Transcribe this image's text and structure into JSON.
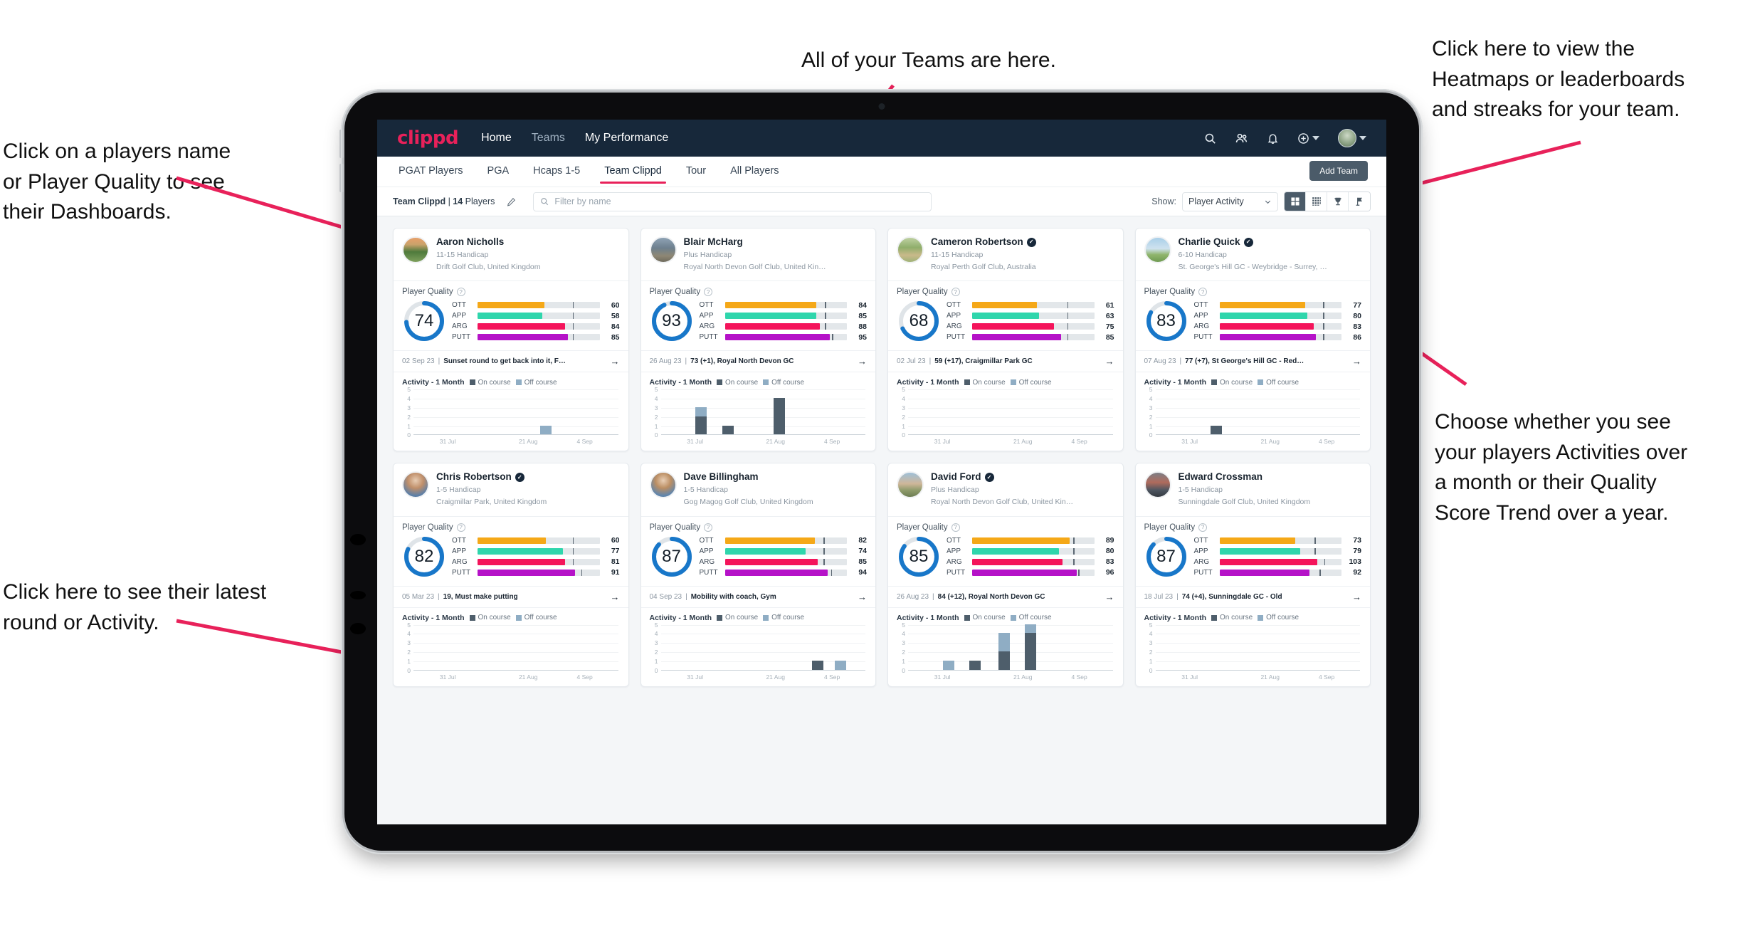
{
  "annotations": [
    {
      "id": "teams",
      "text": "All of your Teams are here."
    },
    {
      "id": "heatmaps",
      "text": "Click here to view the\nHeatmaps or leaderboards\nand streaks for your team."
    },
    {
      "id": "dashboards",
      "text": "Click on a players name\nor Player Quality to see\ntheir Dashboards."
    },
    {
      "id": "activity-choice",
      "text": "Choose whether you see\nyour players Activities over\na month or their Quality\nScore Trend over a year."
    },
    {
      "id": "latest-round",
      "text": "Click here to see their latest\nround or Activity."
    }
  ],
  "colors": {
    "accent_pink": "#e8215a",
    "nav_dark": "#17283a",
    "ring_blue": "#1877c9",
    "ott": "#f5a818",
    "app": "#2fd6ac",
    "arg": "#f4145b",
    "putt": "#b512c8",
    "on_course": "#4e5e6b",
    "off_course": "#8fadc4"
  },
  "header": {
    "logo": "clippd",
    "nav": [
      {
        "label": "Home",
        "active": true
      },
      {
        "label": "Teams",
        "active": false
      },
      {
        "label": "My Performance",
        "active": true
      }
    ],
    "icons": [
      "search-icon",
      "people-icon",
      "bell-icon",
      "plus-circle-icon",
      "avatar"
    ]
  },
  "tabs": [
    {
      "label": "PGAT Players",
      "active": false
    },
    {
      "label": "PGA",
      "active": false
    },
    {
      "label": "Hcaps 1-5",
      "active": false
    },
    {
      "label": "Team Clippd",
      "active": true
    },
    {
      "label": "Tour",
      "active": false
    },
    {
      "label": "All Players",
      "active": false
    }
  ],
  "add_team_label": "Add Team",
  "filterbar": {
    "team_name": "Team Clippd",
    "team_separator": " | ",
    "player_count": "14",
    "players_word": " Players",
    "edit_icon": "pencil-icon",
    "search_placeholder": "Filter by name",
    "show_label": "Show:",
    "show_value": "Player Activity",
    "views": [
      {
        "name": "grid-view-button",
        "icon": "grid-4-icon",
        "active": true
      },
      {
        "name": "dense-grid-view-button",
        "icon": "grid-dots-icon",
        "active": false
      },
      {
        "name": "leaderboard-view-button",
        "icon": "trophy-icon",
        "active": false
      },
      {
        "name": "heatmap-view-button",
        "icon": "flag-icon",
        "active": false
      }
    ]
  },
  "card_labels": {
    "player_quality": "Player Quality",
    "activity": "Activity - 1 Month",
    "legend_on": "On course",
    "legend_off": "Off course",
    "metrics": [
      "OTT",
      "APP",
      "ARG",
      "PUTT"
    ]
  },
  "chart_data": {
    "type": "bar",
    "title": "Activity - 1 Month",
    "ylabel": "",
    "ylim": [
      0,
      5
    ],
    "yticks": [
      0,
      1,
      2,
      3,
      4,
      5
    ],
    "xticks": [
      "31 Jul",
      "21 Aug",
      "4 Sep"
    ],
    "series": [
      {
        "name": "On course",
        "color": "#4e5e6b"
      },
      {
        "name": "Off course",
        "color": "#8fadc4"
      }
    ]
  },
  "players": [
    {
      "name": "Aaron Nicholls",
      "verified": false,
      "handicap": "11-15 Handicap",
      "club": "Drift Golf Club, United Kingdom",
      "quality": 74,
      "metrics": [
        {
          "key": "OTT",
          "value": 60,
          "fill": 55,
          "tick": 78
        },
        {
          "key": "APP",
          "value": 58,
          "fill": 53,
          "tick": 78
        },
        {
          "key": "ARG",
          "value": 84,
          "fill": 72,
          "tick": 78
        },
        {
          "key": "PUTT",
          "value": 85,
          "fill": 74,
          "tick": 78
        }
      ],
      "round_date": "02 Sep 23",
      "round_text": "Sunset round to get back into it, F…",
      "bars": [
        {
          "x": 62,
          "on": 0,
          "off": 1
        }
      ]
    },
    {
      "name": "Blair McHarg",
      "verified": false,
      "handicap": "Plus Handicap",
      "club": "Royal North Devon Golf Club, United Kin…",
      "quality": 93,
      "metrics": [
        {
          "key": "OTT",
          "value": 84,
          "fill": 75,
          "tick": 82
        },
        {
          "key": "APP",
          "value": 85,
          "fill": 75,
          "tick": 82
        },
        {
          "key": "ARG",
          "value": 88,
          "fill": 78,
          "tick": 82
        },
        {
          "key": "PUTT",
          "value": 95,
          "fill": 86,
          "tick": 88
        }
      ],
      "round_date": "26 Aug 23",
      "round_text": "73 (+1), Royal North Devon GC",
      "bars": [
        {
          "x": 17,
          "on": 2,
          "off": 1
        },
        {
          "x": 30,
          "on": 1,
          "off": 0
        },
        {
          "x": 55,
          "on": 4,
          "off": 0
        }
      ]
    },
    {
      "name": "Cameron Robertson",
      "verified": true,
      "handicap": "11-15 Handicap",
      "club": "Royal Perth Golf Club, Australia",
      "quality": 68,
      "metrics": [
        {
          "key": "OTT",
          "value": 61,
          "fill": 53,
          "tick": 78
        },
        {
          "key": "APP",
          "value": 63,
          "fill": 55,
          "tick": 78
        },
        {
          "key": "ARG",
          "value": 75,
          "fill": 67,
          "tick": 78
        },
        {
          "key": "PUTT",
          "value": 85,
          "fill": 73,
          "tick": 78
        }
      ],
      "round_date": "02 Jul 23",
      "round_text": "59 (+17), Craigmillar Park GC",
      "bars": []
    },
    {
      "name": "Charlie Quick",
      "verified": true,
      "handicap": "6-10 Handicap",
      "club": "St. George's Hill GC - Weybridge - Surrey, …",
      "quality": 83,
      "metrics": [
        {
          "key": "OTT",
          "value": 77,
          "fill": 70,
          "tick": 85
        },
        {
          "key": "APP",
          "value": 80,
          "fill": 72,
          "tick": 85
        },
        {
          "key": "ARG",
          "value": 83,
          "fill": 77,
          "tick": 85
        },
        {
          "key": "PUTT",
          "value": 86,
          "fill": 79,
          "tick": 85
        }
      ],
      "round_date": "07 Aug 23",
      "round_text": "77 (+7), St George's Hill GC - Red…",
      "bars": [
        {
          "x": 27,
          "on": 1,
          "off": 0
        }
      ]
    },
    {
      "name": "Chris Robertson",
      "verified": true,
      "handicap": "1-5 Handicap",
      "club": "Craigmillar Park, United Kingdom",
      "quality": 82,
      "metrics": [
        {
          "key": "OTT",
          "value": 60,
          "fill": 56,
          "tick": 78
        },
        {
          "key": "APP",
          "value": 77,
          "fill": 70,
          "tick": 78
        },
        {
          "key": "ARG",
          "value": 81,
          "fill": 72,
          "tick": 78
        },
        {
          "key": "PUTT",
          "value": 91,
          "fill": 80,
          "tick": 85
        }
      ],
      "round_date": "05 Mar 23",
      "round_text": "19, Must make putting",
      "bars": []
    },
    {
      "name": "Dave Billingham",
      "verified": false,
      "handicap": "1-5 Handicap",
      "club": "Gog Magog Golf Club, United Kingdom",
      "quality": 87,
      "metrics": [
        {
          "key": "OTT",
          "value": 82,
          "fill": 74,
          "tick": 81
        },
        {
          "key": "APP",
          "value": 74,
          "fill": 66,
          "tick": 81
        },
        {
          "key": "ARG",
          "value": 85,
          "fill": 76,
          "tick": 81
        },
        {
          "key": "PUTT",
          "value": 94,
          "fill": 84,
          "tick": 87
        }
      ],
      "round_date": "04 Sep 23",
      "round_text": "Mobility with coach, Gym",
      "bars": [
        {
          "x": 74,
          "on": 1,
          "off": 0
        },
        {
          "x": 85,
          "on": 0,
          "off": 1
        }
      ]
    },
    {
      "name": "David Ford",
      "verified": true,
      "handicap": "Plus Handicap",
      "club": "Royal North Devon Golf Club, United Kin…",
      "quality": 85,
      "metrics": [
        {
          "key": "OTT",
          "value": 89,
          "fill": 80,
          "tick": 83
        },
        {
          "key": "APP",
          "value": 80,
          "fill": 71,
          "tick": 83
        },
        {
          "key": "ARG",
          "value": 83,
          "fill": 74,
          "tick": 83
        },
        {
          "key": "PUTT",
          "value": 96,
          "fill": 86,
          "tick": 87
        }
      ],
      "round_date": "26 Aug 23",
      "round_text": "84 (+12), Royal North Devon GC",
      "bars": [
        {
          "x": 17,
          "on": 0,
          "off": 1
        },
        {
          "x": 30,
          "on": 1,
          "off": 0
        },
        {
          "x": 44,
          "on": 2,
          "off": 2
        },
        {
          "x": 57,
          "on": 4,
          "off": 1
        }
      ]
    },
    {
      "name": "Edward Crossman",
      "verified": false,
      "handicap": "1-5 Handicap",
      "club": "Sunningdale Golf Club, United Kingdom",
      "quality": 87,
      "metrics": [
        {
          "key": "OTT",
          "value": 73,
          "fill": 62,
          "tick": 78
        },
        {
          "key": "APP",
          "value": 79,
          "fill": 66,
          "tick": 78
        },
        {
          "key": "ARG",
          "value": 103,
          "fill": 80,
          "tick": 86
        },
        {
          "key": "PUTT",
          "value": 92,
          "fill": 74,
          "tick": 82
        }
      ],
      "round_date": "18 Jul 23",
      "round_text": "74 (+4), Sunningdale GC - Old",
      "bars": []
    }
  ]
}
